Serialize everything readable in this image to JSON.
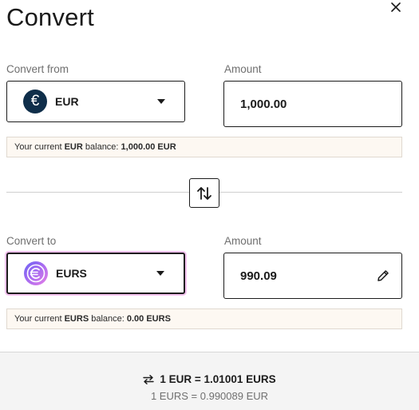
{
  "dialog": {
    "title": "Convert"
  },
  "from": {
    "label": "Convert from",
    "currency": "EUR",
    "coin_symbol": "€",
    "amount_label": "Amount",
    "amount": "1,000.00",
    "balance_prefix": "Your current",
    "balance_currency": "EUR",
    "balance_mid": "balance:",
    "balance_value": "1,000.00 EUR"
  },
  "to": {
    "label": "Convert to",
    "currency": "EURS",
    "amount_label": "Amount",
    "amount": "990.09",
    "balance_prefix": "Your current",
    "balance_currency": "EURS",
    "balance_mid": "balance:",
    "balance_value": "0.00 EURS"
  },
  "rates": {
    "primary": "1 EUR = 1.01001 EURS",
    "secondary": "1 EURS = 0.990089 EUR"
  },
  "colors": {
    "eur_coin": "#0f2e4a",
    "focus_ring": "#f3c2ee",
    "balance_bg": "#fdf8f2",
    "footer_bg": "#f4f4f4"
  }
}
